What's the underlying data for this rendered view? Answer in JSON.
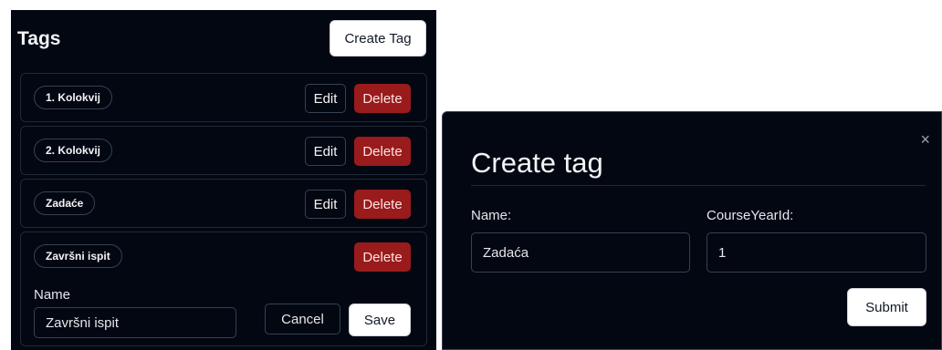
{
  "tags_panel": {
    "title": "Tags",
    "create_button": "Create Tag",
    "rows": [
      {
        "name": "1. Kolokvij",
        "edit": "Edit",
        "delete": "Delete"
      },
      {
        "name": "2. Kolokvij",
        "edit": "Edit",
        "delete": "Delete"
      },
      {
        "name": "Zadaće",
        "edit": "Edit",
        "delete": "Delete"
      },
      {
        "name": "Završni ispit",
        "delete": "Delete",
        "edit_form": {
          "label": "Name",
          "value": "Završni ispit",
          "cancel": "Cancel",
          "save": "Save"
        }
      }
    ]
  },
  "create_modal": {
    "title": "Create tag",
    "close_glyph": "×",
    "name_label": "Name:",
    "name_value": "Zadaća",
    "course_year_label": "CourseYearId:",
    "course_year_value": "1",
    "submit": "Submit"
  },
  "colors": {
    "background": "#030712",
    "delete": "#991b1b",
    "border": "#374151"
  }
}
